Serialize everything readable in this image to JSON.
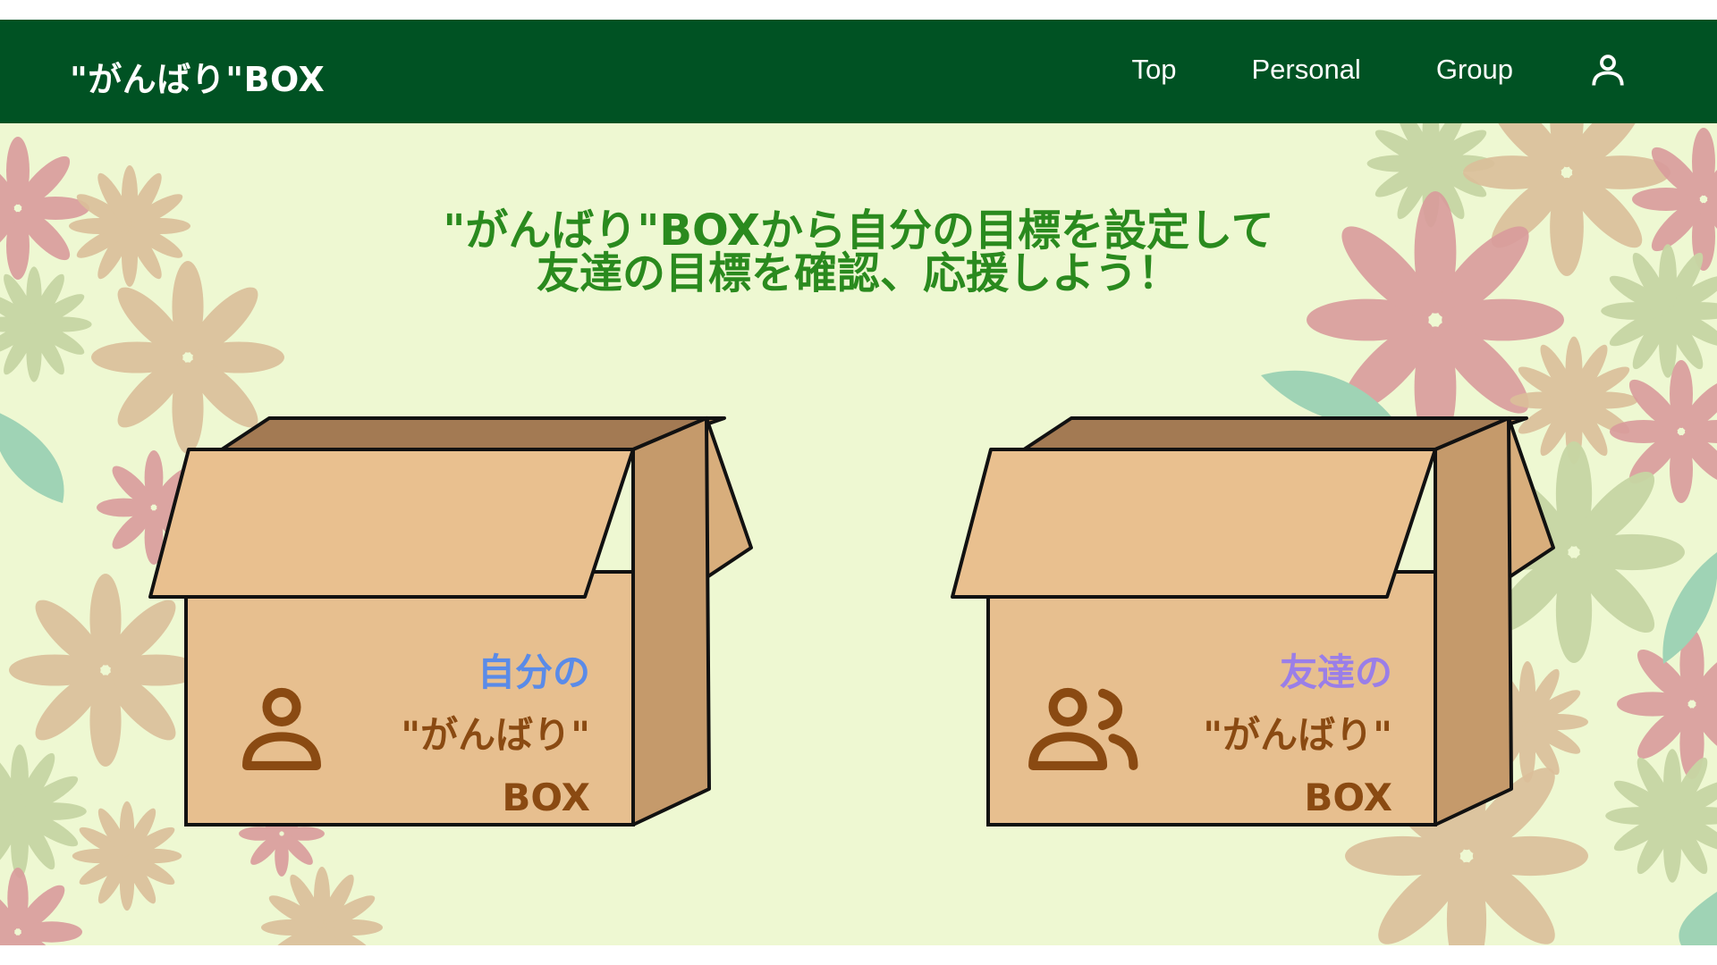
{
  "header": {
    "brand": "\"がんばり\"BOX",
    "nav": [
      "Top",
      "Personal",
      "Group"
    ]
  },
  "main": {
    "headline": [
      "\"がんばり\"BOXから自分の目標を設定して",
      "友達の目標を確認、応援しよう！"
    ],
    "boxes": [
      {
        "line1": "自分の",
        "line2": "\"がんばり\"",
        "line3": "BOX",
        "icon": "user-icon",
        "accent": "#5a8be8"
      },
      {
        "line1": "友達の",
        "line2": "\"がんばり\"",
        "line3": "BOX",
        "icon": "users-icon",
        "accent": "#9a7ee8"
      }
    ]
  },
  "colors": {
    "navbar": "#005223",
    "background": "#eef8d2",
    "headline": "#2a8a1e",
    "box_text": "#8a4a12"
  }
}
